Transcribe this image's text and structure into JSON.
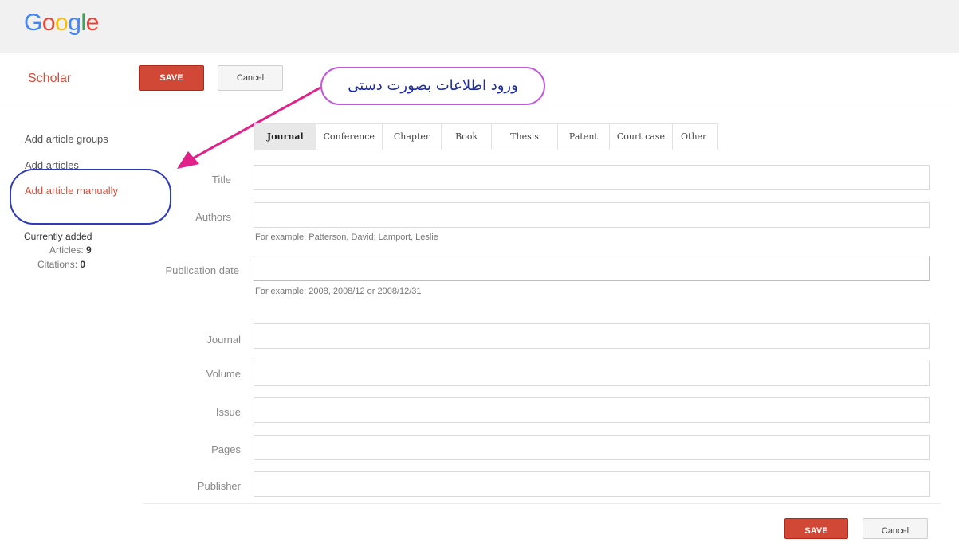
{
  "header": {
    "logo_text": "Google",
    "logo_colors": [
      "#4285f4",
      "#ea4335",
      "#fbbc05",
      "#4285f4",
      "#34a853",
      "#ea4335"
    ],
    "app_title": "Scholar",
    "save_label": "SAVE",
    "cancel_label": "Cancel"
  },
  "annotation": {
    "text": "ورود اطلاعات بصورت دستی",
    "bubble_color": "#c15ad8",
    "arrow_color": "#e0218a",
    "circle_color": "#2f3bb8"
  },
  "sidebar": {
    "items": [
      {
        "label": "Add article groups",
        "active": false
      },
      {
        "label": "Add articles",
        "active": false
      },
      {
        "label": "Add article manually",
        "active": true
      }
    ],
    "currently_added_label": "Currently added",
    "articles_label": "Articles:",
    "articles_count": "9",
    "citations_label": "Citations:",
    "citations_count": "0"
  },
  "tabs": [
    {
      "label": "Journal",
      "selected": true
    },
    {
      "label": "Conference",
      "selected": false
    },
    {
      "label": "Chapter",
      "selected": false
    },
    {
      "label": "Book",
      "selected": false
    },
    {
      "label": "Thesis",
      "selected": false
    },
    {
      "label": "Patent",
      "selected": false
    },
    {
      "label": "Court case",
      "selected": false
    },
    {
      "label": "Other",
      "selected": false
    }
  ],
  "form": {
    "title_label": "Title",
    "authors_label": "Authors",
    "authors_hint": "For example: Patterson, David; Lamport, Leslie",
    "pubdate_label": "Publication date",
    "pubdate_hint": "For example: 2008, 2008/12 or 2008/12/31",
    "journal_label": "Journal",
    "volume_label": "Volume",
    "issue_label": "Issue",
    "pages_label": "Pages",
    "publisher_label": "Publisher"
  },
  "footer": {
    "save_label": "SAVE",
    "cancel_label": "Cancel"
  },
  "colors": {
    "accent": "#d14836",
    "scholar_red": "#dd4b39"
  }
}
